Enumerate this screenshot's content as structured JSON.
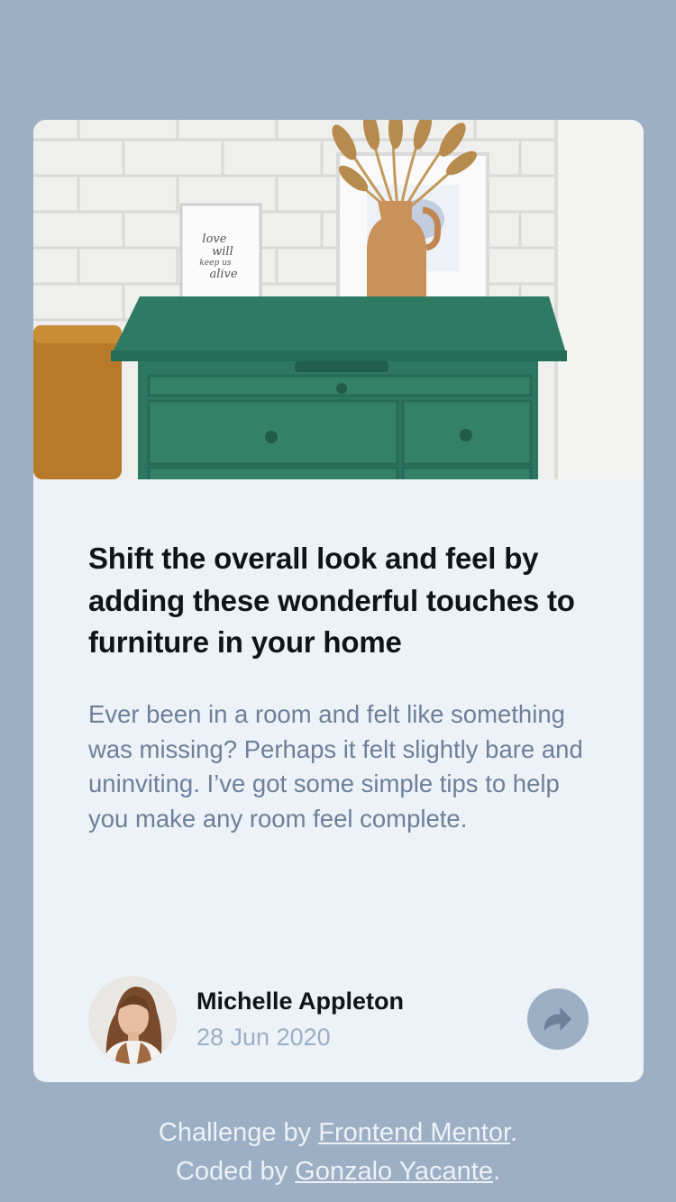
{
  "card": {
    "image_alt": "Green drawers with vase and framed print",
    "frame_text": [
      "love",
      "will",
      "keep us",
      "alive"
    ],
    "title": "Shift the overall look and feel by adding these wonderful touches to furniture in your home",
    "excerpt": "Ever been in a room and felt like something was missing? Perhaps it felt slightly bare and uninviting. I’ve got some simple tips to help you make any room feel complete.",
    "author": {
      "name": "Michelle Appleton",
      "date": "28 Jun 2020"
    },
    "share_icon": "share-arrow-icon"
  },
  "attribution": {
    "line1_prefix": "Challenge by ",
    "line1_link": "Frontend Mentor",
    "line1_suffix": ".",
    "line2_prefix": "Coded by ",
    "line2_link": "Gonzalo Yacante",
    "line2_suffix": "."
  },
  "colors": {
    "page_bg": "#9CAFC4",
    "card_bg": "#ECF2F8",
    "title": "#0f1419",
    "body_text": "#6E8098",
    "muted": "#9CAFC4",
    "furniture_green": "#2f7a62",
    "vase": "#c9925a"
  }
}
